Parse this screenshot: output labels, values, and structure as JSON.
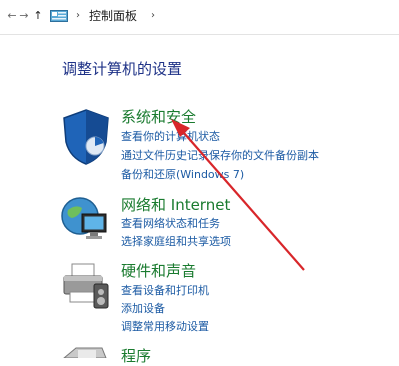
{
  "breadcrumb": {
    "back_glyph": "←",
    "forward_glyph": "→",
    "up_glyph": "↑",
    "separator": "›",
    "current": "控制面板"
  },
  "page": {
    "title": "调整计算机的设置"
  },
  "categories": [
    {
      "title": "系统和安全",
      "links": [
        "查看你的计算机状态",
        "通过文件历史记录保存你的文件备份副本",
        "备份和还原(Windows 7)"
      ]
    },
    {
      "title": "网络和 Internet",
      "links": [
        "查看网络状态和任务",
        "选择家庭组和共享选项"
      ]
    },
    {
      "title": "硬件和声音",
      "links": [
        "查看设备和打印机",
        "添加设备",
        "调整常用移动设置"
      ]
    },
    {
      "title": "程序",
      "links": []
    }
  ],
  "colors": {
    "title": "#1e3287",
    "category": "#1a7b2f",
    "link": "#1b5aa3",
    "annotation": "#d8262a"
  },
  "icons": {
    "back": "back-arrow-icon",
    "forward": "forward-arrow-icon",
    "up": "up-arrow-icon",
    "address": "control-panel-icon",
    "system": "shield-icon",
    "network": "network-globe-icon",
    "hardware": "printer-icon",
    "programs": "programs-icon"
  }
}
